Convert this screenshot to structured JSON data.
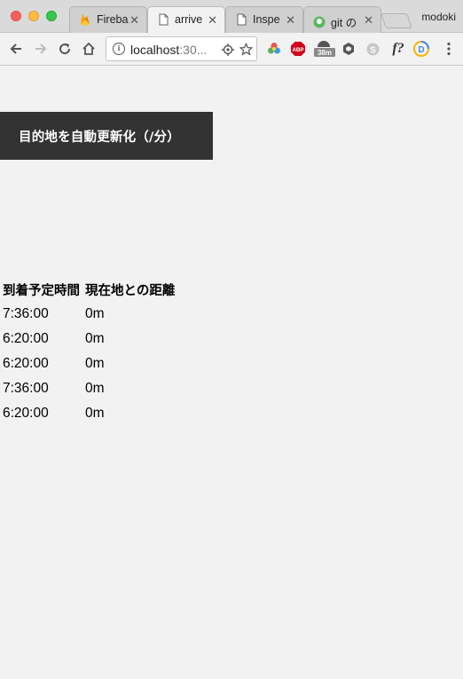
{
  "browser": {
    "tabs": [
      {
        "title": "Fireba",
        "favicon": "firebase-icon"
      },
      {
        "title": "arrive",
        "favicon": "page-icon",
        "active": true
      },
      {
        "title": "Inspe",
        "favicon": "page-icon"
      },
      {
        "title": "git の",
        "favicon": "git-icon"
      }
    ],
    "profile_name": "modoki",
    "address_host": "localhost",
    "address_rest": ":30...",
    "extension_badge": "38m",
    "ext_abp_label": "ABP",
    "ext_f_label": "f?"
  },
  "page": {
    "update_button_label": "目的地を自動更新化（/分）",
    "table": {
      "headers": [
        "到着予定時間",
        "現在地との距離"
      ],
      "rows": [
        [
          "7:36:00",
          "0m"
        ],
        [
          "6:20:00",
          "0m"
        ],
        [
          "6:20:00",
          "0m"
        ],
        [
          "7:36:00",
          "0m"
        ],
        [
          "6:20:00",
          "0m"
        ]
      ]
    }
  },
  "colors": {
    "page_bg": "#f2f2f2",
    "button_bg": "#333333",
    "button_text": "#ffffff"
  }
}
